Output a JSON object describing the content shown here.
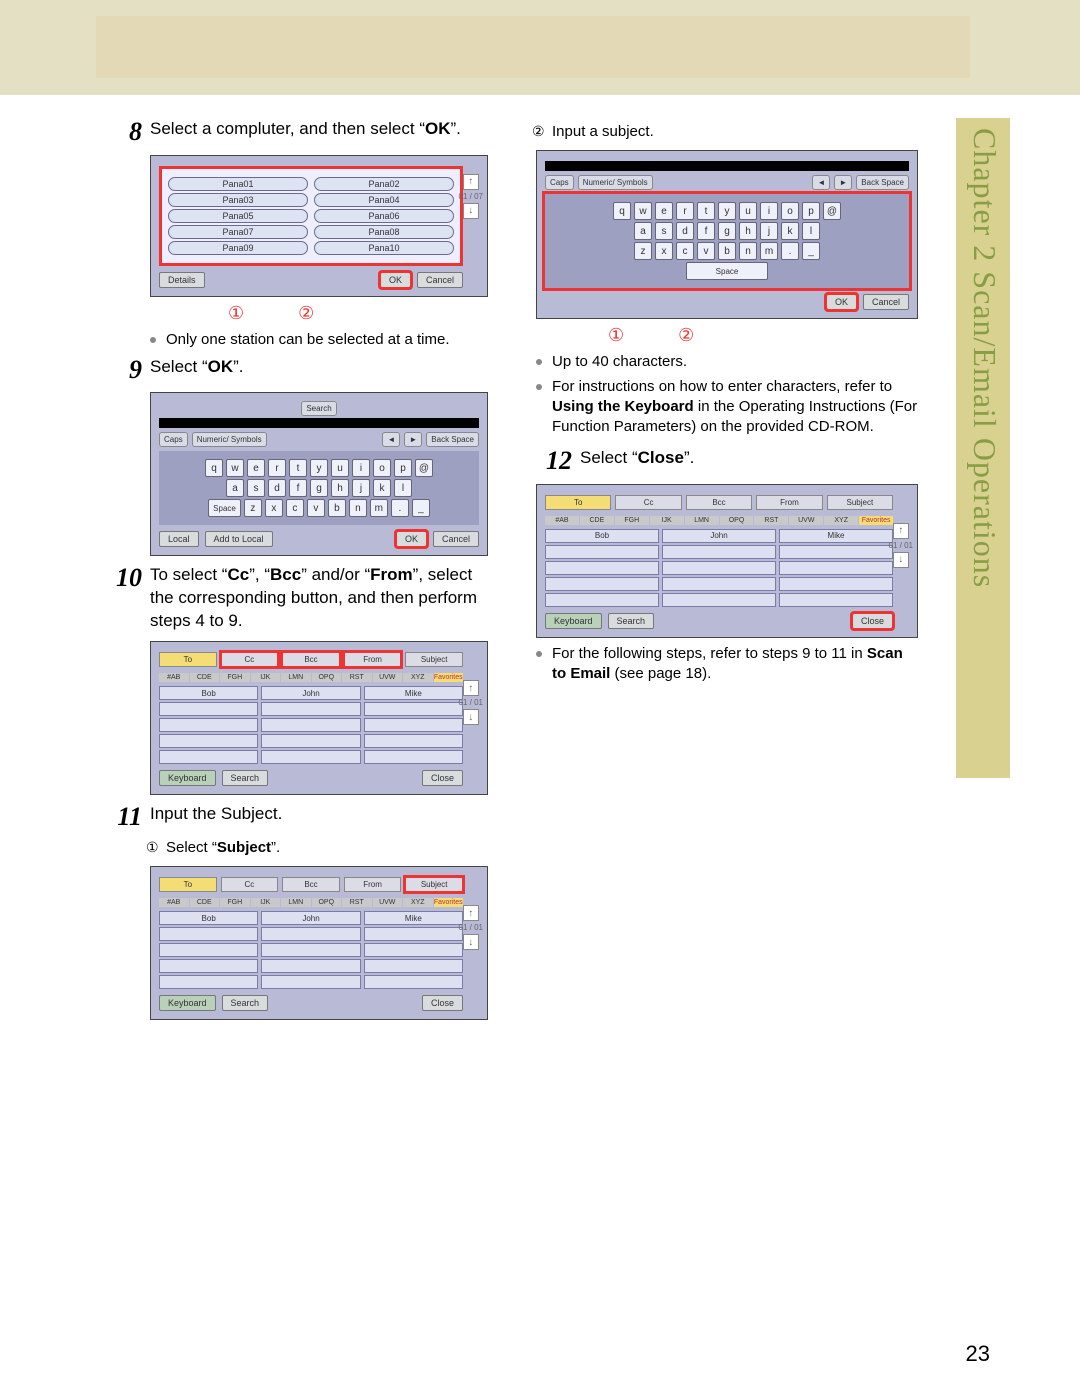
{
  "chapter_side": "Chapter 2   Scan/Email Operations",
  "page_number": "23",
  "steps": {
    "8": {
      "text_pre": "Select a compluter, and then select “",
      "bold": "OK",
      "text_post": "”."
    },
    "8_note": "Only one station can be selected at a time.",
    "9": {
      "text_pre": "Select “",
      "bold": "OK",
      "text_post": "”."
    },
    "10": "To select “Cc”, “Bcc” and/or “From”, select the corresponding button, and then perform steps 4 to 9.",
    "10_bold1": "Cc",
    "10_bold2": "Bcc",
    "10_bold3": "From",
    "10_text": "To select “",
    "10_mid1": "”, “",
    "10_mid2": "” and/or “",
    "10_mid3": "”, select the corresponding button, and then perform steps 4 to 9.",
    "11": "Input the Subject.",
    "11_sub1_pre": "Select “",
    "11_sub1_bold": "Subject",
    "11_sub1_post": "”.",
    "11_sub2": "Input a subject.",
    "11_note1": "Up to 40 characters.",
    "11_note2_pre": "For instructions on how to enter characters, refer to ",
    "11_note2_bold": "Using the Keyboard",
    "11_note2_post": " in the Operating Instructions (For Function Parameters) on the provided CD-ROM.",
    "12_pre": "Select “",
    "12_bold": "Close",
    "12_post": "”.",
    "12_note_pre": "For the following steps, refer to steps 9 to 11 in ",
    "12_note_bold": "Scan to Email",
    "12_note_post": " (see page 18)."
  },
  "callouts": {
    "one": "①",
    "two": "②"
  },
  "fig8": {
    "items": [
      "Pana01",
      "Pana02",
      "Pana03",
      "Pana04",
      "Pana05",
      "Pana06",
      "Pana07",
      "Pana08",
      "Pana09",
      "Pana10"
    ],
    "details": "Details",
    "ok": "OK",
    "cancel": "Cancel",
    "scroll": "01 / 07"
  },
  "fig9": {
    "search": "Search",
    "caps": "Caps",
    "ns": "Numeric/ Symbols",
    "back_space": "Back Space",
    "row1": [
      "q",
      "w",
      "e",
      "r",
      "t",
      "y",
      "u",
      "i",
      "o",
      "p",
      "@"
    ],
    "row2": [
      "a",
      "s",
      "d",
      "f",
      "g",
      "h",
      "j",
      "k",
      "l"
    ],
    "row3": [
      "z",
      "x",
      "c",
      "v",
      "b",
      "n",
      "m",
      ".",
      "_"
    ],
    "space_lbl": "Space",
    "local": "Local",
    "add_local": "Add to Local",
    "ok": "OK",
    "cancel": "Cancel"
  },
  "fig10": {
    "tabs": [
      "To",
      "Cc",
      "Bcc",
      "From",
      "Subject"
    ],
    "alpha": [
      "#AB",
      "CDE",
      "FGH",
      "IJK",
      "LMN",
      "OPQ",
      "RST",
      "UVW",
      "XYZ",
      "Favorites"
    ],
    "names": [
      "Bob",
      "John",
      "Mike"
    ],
    "keyboard": "Keyboard",
    "search": "Search",
    "close": "Close",
    "scroll": "01 / 01"
  },
  "fig_kbd2": {
    "caps": "Caps",
    "ns": "Numeric/ Symbols",
    "back_space": "Back Space",
    "row1": [
      "q",
      "w",
      "e",
      "r",
      "t",
      "y",
      "u",
      "i",
      "o",
      "p",
      "@"
    ],
    "row2": [
      "a",
      "s",
      "d",
      "f",
      "g",
      "h",
      "j",
      "k",
      "l"
    ],
    "row3": [
      "z",
      "x",
      "c",
      "v",
      "b",
      "n",
      "m",
      ".",
      "_"
    ],
    "space": "Space",
    "ok": "OK",
    "cancel": "Cancel"
  }
}
